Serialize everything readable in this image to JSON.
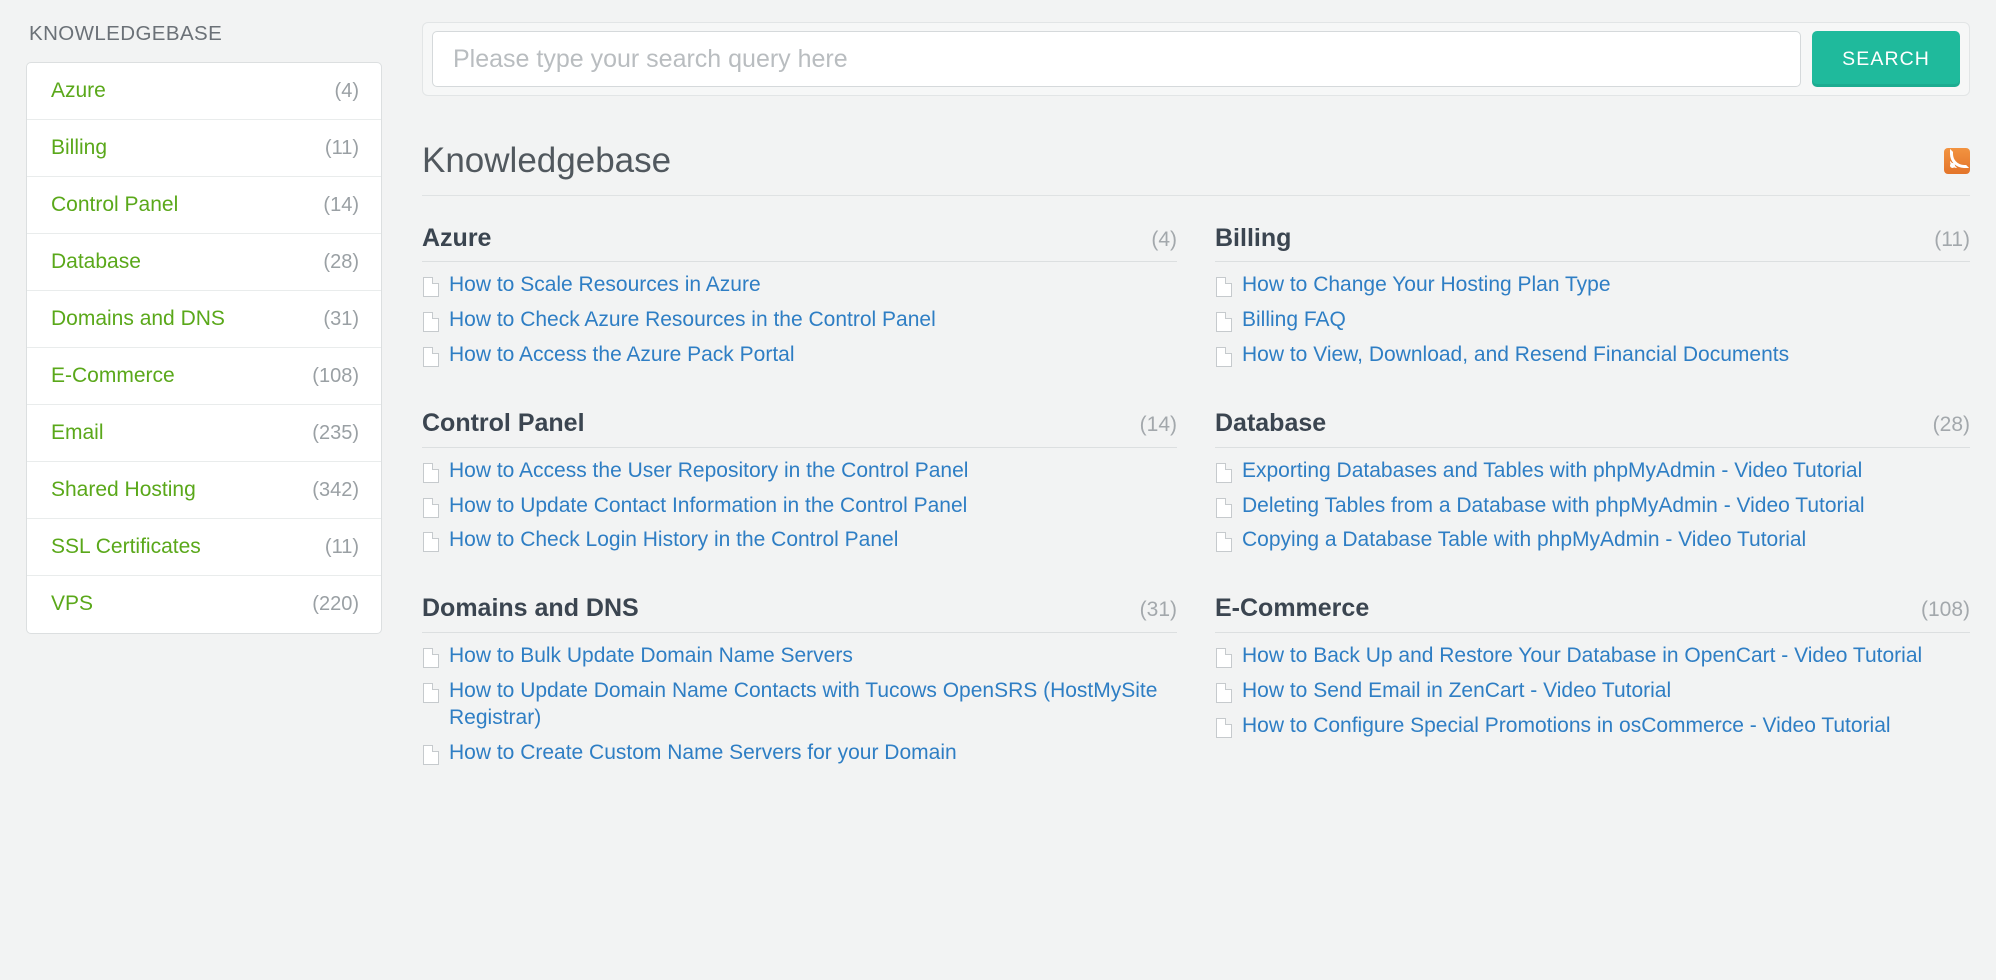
{
  "sidebar": {
    "title": "KNOWLEDGEBASE",
    "items": [
      {
        "label": "Azure",
        "count": "(4)"
      },
      {
        "label": "Billing",
        "count": "(11)"
      },
      {
        "label": "Control Panel",
        "count": "(14)"
      },
      {
        "label": "Database",
        "count": "(28)"
      },
      {
        "label": "Domains and DNS",
        "count": "(31)"
      },
      {
        "label": "E-Commerce",
        "count": "(108)"
      },
      {
        "label": "Email",
        "count": "(235)"
      },
      {
        "label": "Shared Hosting",
        "count": "(342)"
      },
      {
        "label": "SSL Certificates",
        "count": "(11)"
      },
      {
        "label": "VPS",
        "count": "(220)"
      }
    ]
  },
  "search": {
    "placeholder": "Please type your search query here",
    "value": "",
    "button_label": "SEARCH"
  },
  "main": {
    "page_title": "Knowledgebase",
    "feed_icon": "rss-icon",
    "sections": [
      {
        "title": "Azure",
        "count": "(4)",
        "articles": [
          "How to Scale Resources in Azure",
          "How to Check Azure Resources in the Control Panel",
          "How to Access the Azure Pack Portal"
        ]
      },
      {
        "title": "Billing",
        "count": "(11)",
        "articles": [
          "How to Change Your Hosting Plan Type",
          "Billing FAQ",
          "How to View, Download, and Resend Financial Documents"
        ]
      },
      {
        "title": "Control Panel",
        "count": "(14)",
        "articles": [
          "How to Access the User Repository in the Control Panel",
          "How to Update Contact Information in the Control Panel",
          "How to Check Login History in the Control Panel"
        ]
      },
      {
        "title": "Database",
        "count": "(28)",
        "articles": [
          "Exporting Databases and Tables with phpMyAdmin - Video Tutorial",
          "Deleting Tables from a Database with phpMyAdmin - Video Tutorial",
          "Copying a Database Table with phpMyAdmin - Video Tutorial"
        ]
      },
      {
        "title": "Domains and DNS",
        "count": "(31)",
        "articles": [
          "How to Bulk Update Domain Name Servers",
          "How to Update Domain Name Contacts with Tucows OpenSRS (HostMySite Registrar)",
          "How to Create Custom Name Servers for your Domain"
        ]
      },
      {
        "title": "E-Commerce",
        "count": "(108)",
        "articles": [
          "How to Back Up and Restore Your Database in OpenCart - Video Tutorial",
          "How to Send Email in ZenCart - Video Tutorial",
          "How to Configure Special Promotions in osCommerce - Video Tutorial"
        ]
      }
    ]
  },
  "colors": {
    "accent_green": "#5aa81a",
    "link_blue": "#2e7ec4",
    "search_button": "#1fba9c",
    "rss_orange": "#e3742a",
    "page_background": "#f2f3f3"
  }
}
